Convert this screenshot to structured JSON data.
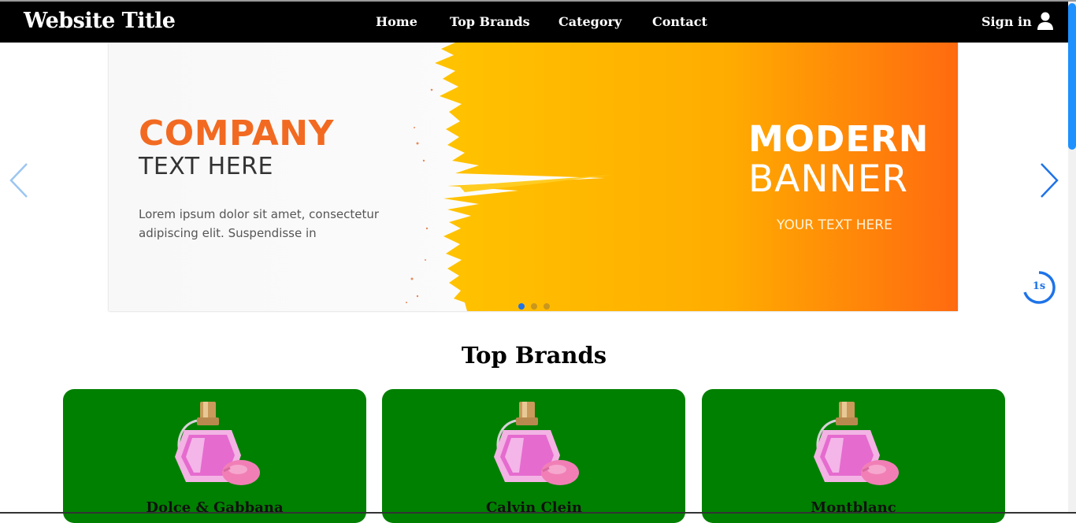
{
  "header": {
    "site_title": "Website Title",
    "nav": [
      "Home",
      "Top Brands",
      "Category",
      "Contact"
    ],
    "sign_in": "Sign in"
  },
  "slider": {
    "company": "COMPANY",
    "text_here": "TEXT HERE",
    "lorem": "Lorem ipsum dolor sit amet, consectetur adipiscing elit. Suspendisse in",
    "modern": "MODERN",
    "banner": "BANNER",
    "your_text": "YOUR TEXT HERE",
    "active_dot": 1,
    "dot_count": 3,
    "timer": "1s",
    "accent_color": "#1e73e8"
  },
  "brands": {
    "title": "Top Brands",
    "items": [
      "Dolce & Gabbana",
      "Calvin Clein",
      "Montblanc"
    ],
    "card_color": "#008000"
  }
}
